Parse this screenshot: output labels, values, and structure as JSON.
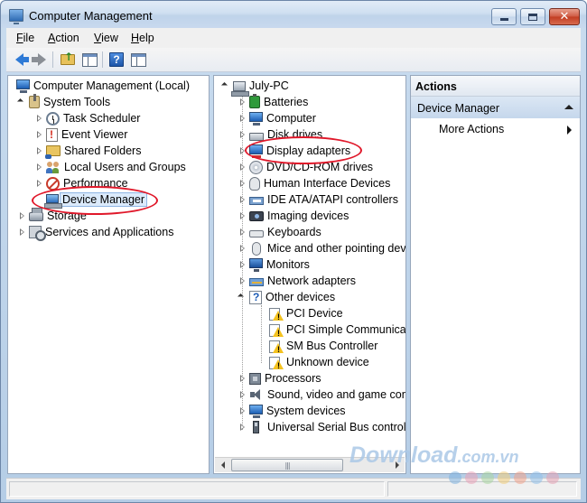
{
  "window": {
    "title": "Computer Management"
  },
  "menu": [
    {
      "accel": "F",
      "rest": "ile"
    },
    {
      "accel": "A",
      "rest": "ction"
    },
    {
      "accel": "V",
      "rest": "iew"
    },
    {
      "accel": "H",
      "rest": "elp"
    }
  ],
  "left_tree": {
    "root": "Computer Management (Local)",
    "system_tools": "System Tools",
    "task_scheduler": "Task Scheduler",
    "event_viewer": "Event Viewer",
    "shared_folders": "Shared Folders",
    "local_users": "Local Users and Groups",
    "performance": "Performance",
    "device_manager": "Device Manager",
    "storage": "Storage",
    "services": "Services and Applications"
  },
  "device_tree": {
    "root": "July-PC",
    "batteries": "Batteries",
    "computer": "Computer",
    "disk_drives": "Disk drives",
    "display_adapters": "Display adapters",
    "dvd": "DVD/CD-ROM drives",
    "hid": "Human Interface Devices",
    "ide": "IDE ATA/ATAPI controllers",
    "imaging": "Imaging devices",
    "keyboards": "Keyboards",
    "mice": "Mice and other pointing dev",
    "monitors": "Monitors",
    "network": "Network adapters",
    "other": "Other devices",
    "pci_device": "PCI Device",
    "pci_simple": "PCI Simple Communicat",
    "smbus": "SM Bus Controller",
    "unknown": "Unknown device",
    "processors": "Processors",
    "sound": "Sound, video and game con",
    "system": "System devices",
    "usb": "Universal Serial Bus controlle"
  },
  "actions": {
    "header": "Actions",
    "section": "Device Manager",
    "more": "More Actions"
  },
  "scrollbar": {
    "grip": "|||"
  },
  "watermark": {
    "main": "Download",
    "sub": ".com.vn"
  },
  "colors": {
    "highlight_ellipse": "#e0182a",
    "selection": "#dbeafb"
  }
}
